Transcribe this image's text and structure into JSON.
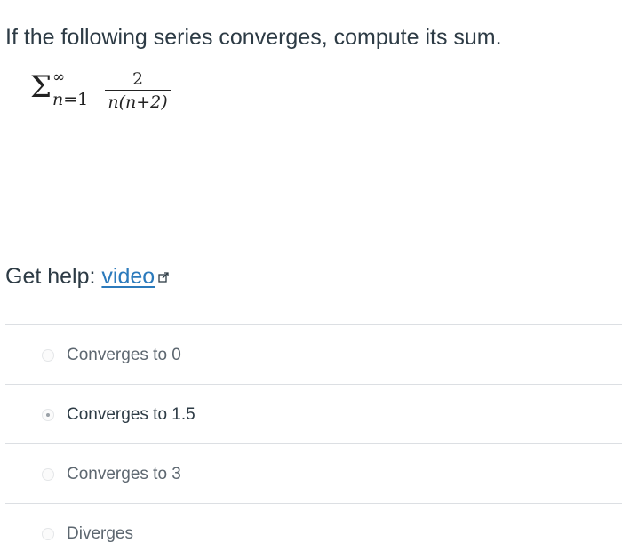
{
  "question": {
    "text": "If the following series converges, compute its sum."
  },
  "formula": {
    "sigma": "Σ",
    "upper_limit": "∞",
    "index_var": "n",
    "index_start": "=1",
    "numerator": "2",
    "denominator": "n(n+2)"
  },
  "help": {
    "prefix": "Get help: ",
    "link_label": "video",
    "link_icon": "external-link-icon"
  },
  "options": [
    {
      "label": "Converges to 0",
      "selected": false
    },
    {
      "label": "Converges to 1.5",
      "selected": true
    },
    {
      "label": "Converges to 3",
      "selected": false
    },
    {
      "label": "Diverges",
      "selected": false
    }
  ],
  "colors": {
    "text": "#2d3b45",
    "link": "#2b7abc",
    "muted_option": "#5d6770",
    "divider": "#dcdfe3"
  }
}
